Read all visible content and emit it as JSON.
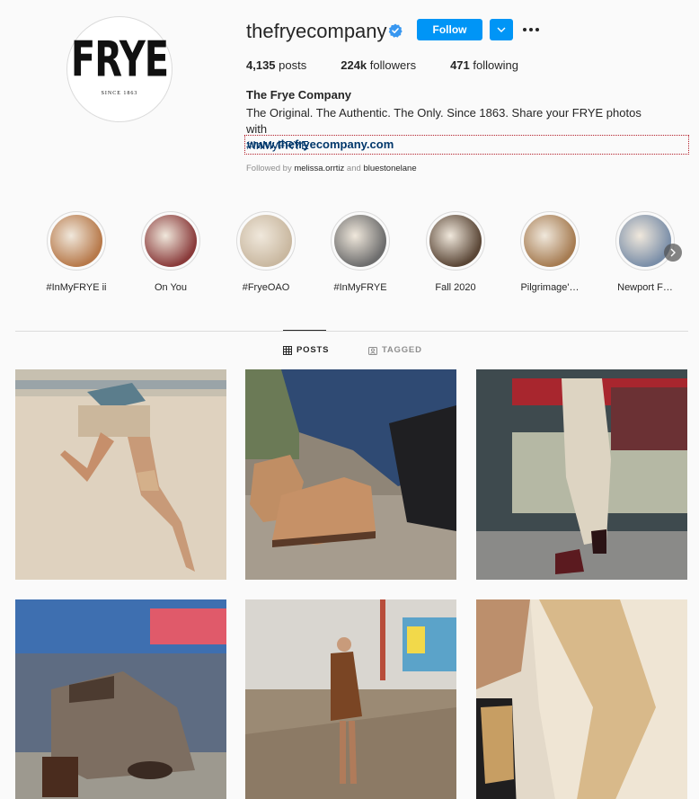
{
  "profile": {
    "username": "thefryecompany",
    "logo_word": "FRYE",
    "logo_sub": "SINCE 1863",
    "follow_label": "Follow",
    "stats": {
      "posts_count": "4,135",
      "posts_label": " posts",
      "followers_count": "224k",
      "followers_label": " followers",
      "following_count": "471",
      "following_label": " following"
    },
    "full_name": "The Frye Company",
    "bio": "The Original. The Authentic. The Only. Since 1863. Share your FRYE photos with",
    "bio_hashtag": "#InMyFRYE",
    "website": "www.thefryecompany.com",
    "followed_by_prefix": "Followed by ",
    "followed_by_user1": "melissa.orrtiz",
    "followed_by_and": " and ",
    "followed_by_user2": "bluestonelane"
  },
  "highlights": [
    {
      "label": "#InMyFRYE ii",
      "color": "#b7794a"
    },
    {
      "label": "On You",
      "color": "#8a3b3b"
    },
    {
      "label": "#FryeOAO",
      "color": "#c9b8a0"
    },
    {
      "label": "#InMyFRYE",
      "color": "#6d6d6d"
    },
    {
      "label": "Fall 2020",
      "color": "#5a4636"
    },
    {
      "label": "Pilgrimage'…",
      "color": "#a67c52"
    },
    {
      "label": "Newport F…",
      "color": "#7a8ea8"
    }
  ],
  "tabs": {
    "posts": "POSTS",
    "tagged": "TAGGED"
  },
  "icons": {
    "verified": "verified-badge-icon",
    "dropdown": "chevron-down-icon",
    "more": "more-options-icon",
    "posts_tab": "grid-icon",
    "tagged_tab": "tagged-icon",
    "next": "chevron-right-icon"
  },
  "colors": {
    "accent": "#0095f6",
    "link": "#00376b",
    "muted": "#8e8e8e"
  }
}
